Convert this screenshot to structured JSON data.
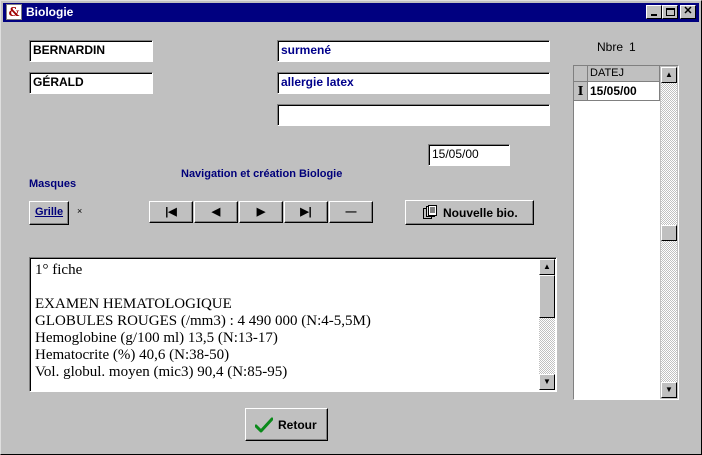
{
  "window": {
    "title": "Biologie",
    "app_icon": "app-icon",
    "minimize_icon": "minimize-icon",
    "maximize_icon": "maximize-icon",
    "close_icon": "close-icon"
  },
  "patient": {
    "last_name": "BERNARDIN",
    "first_name": "GÉRALD",
    "note1": "surmené",
    "note2": "allergie latex",
    "note3": ""
  },
  "date_field": "15/05/00",
  "masks_label": "Masques",
  "grille_button": "Grille",
  "grille_marker": "×",
  "navigation_label": "Navigation et création Biologie",
  "nav_buttons": {
    "first": "|◀",
    "previous": "◀",
    "next": "▶",
    "last": "▶|",
    "delete": "—"
  },
  "new_bio_button": "Nouvelle bio.",
  "new_bio_icon": "document-stack-icon",
  "memo_lines": [
    "1° fiche",
    "",
    "EXAMEN HEMATOLOGIQUE",
    "GLOBULES ROUGES (/mm3) : 4 490 000 (N:4-5,5M)",
    "Hemoglobine (g/100 ml) 13,5 (N:13-17)",
    "Hematocrite (%) 40,6 (N:38-50)",
    "Vol. globul. moyen (mic3) 90,4 (N:85-95)"
  ],
  "count_label": "Nbre",
  "count_value": "1",
  "grid": {
    "column_header": "DATEJ",
    "rows": [
      "15/05/00"
    ],
    "current_row_marker": "I"
  },
  "return_button": "Retour",
  "return_icon": "checkmark-icon",
  "colors": {
    "titlebar": "#000080",
    "face": "#c0c0c0",
    "accent_text": "#00008b",
    "check_green": "#0a8a1a"
  }
}
